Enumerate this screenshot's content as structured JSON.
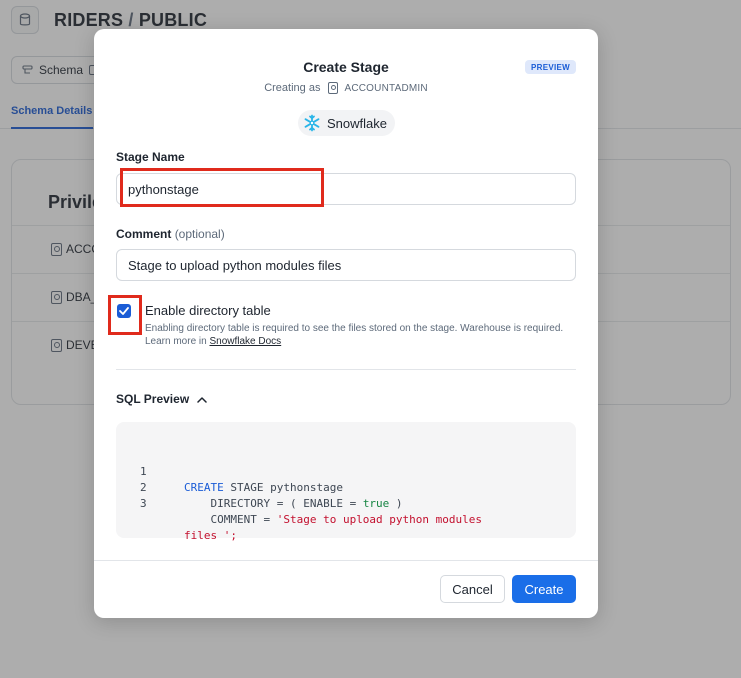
{
  "background": {
    "title_db": "RIDERS",
    "title_slash": "/",
    "title_schema": "PUBLIC",
    "toolbar": {
      "schema_label": "Schema"
    },
    "tab_active": "Schema Details",
    "card_heading": "Privile",
    "privilege_rows": [
      "ACCO",
      "DBA_",
      "DEVE"
    ]
  },
  "modal": {
    "title": "Create Stage",
    "badge": "PREVIEW",
    "creating_as_label": "Creating as",
    "role": "ACCOUNTADMIN",
    "connection_label": "Snowflake",
    "stage_name": {
      "label": "Stage Name",
      "value": "pythonstage"
    },
    "comment": {
      "label": "Comment",
      "optional": "(optional)",
      "value": "Stage to upload python modules files"
    },
    "directory_table": {
      "label": "Enable directory table",
      "checked": true,
      "help": "Enabling directory table is required to see the files stored on the stage. Warehouse is required. Learn more in",
      "link": "Snowflake Docs"
    },
    "sql_preview": {
      "label": "SQL Preview",
      "lines": [
        {
          "num": "1",
          "kw": "CREATE",
          "rest": " STAGE pythonstage"
        },
        {
          "num": "2",
          "pre": "    DIRECTORY = ( ENABLE = ",
          "val": "true",
          "post": " )"
        },
        {
          "num": "3",
          "pre": "    COMMENT = ",
          "str": "'Stage to upload python modules"
        },
        {
          "num": "",
          "str": "files ';"
        }
      ]
    },
    "cancel_label": "Cancel",
    "create_label": "Create"
  },
  "colors": {
    "accent": "#1a5cd6",
    "highlight": "#e02a1c",
    "keyword": "#1a5cd6",
    "string": "#c3112f",
    "boolean": "#158441"
  }
}
